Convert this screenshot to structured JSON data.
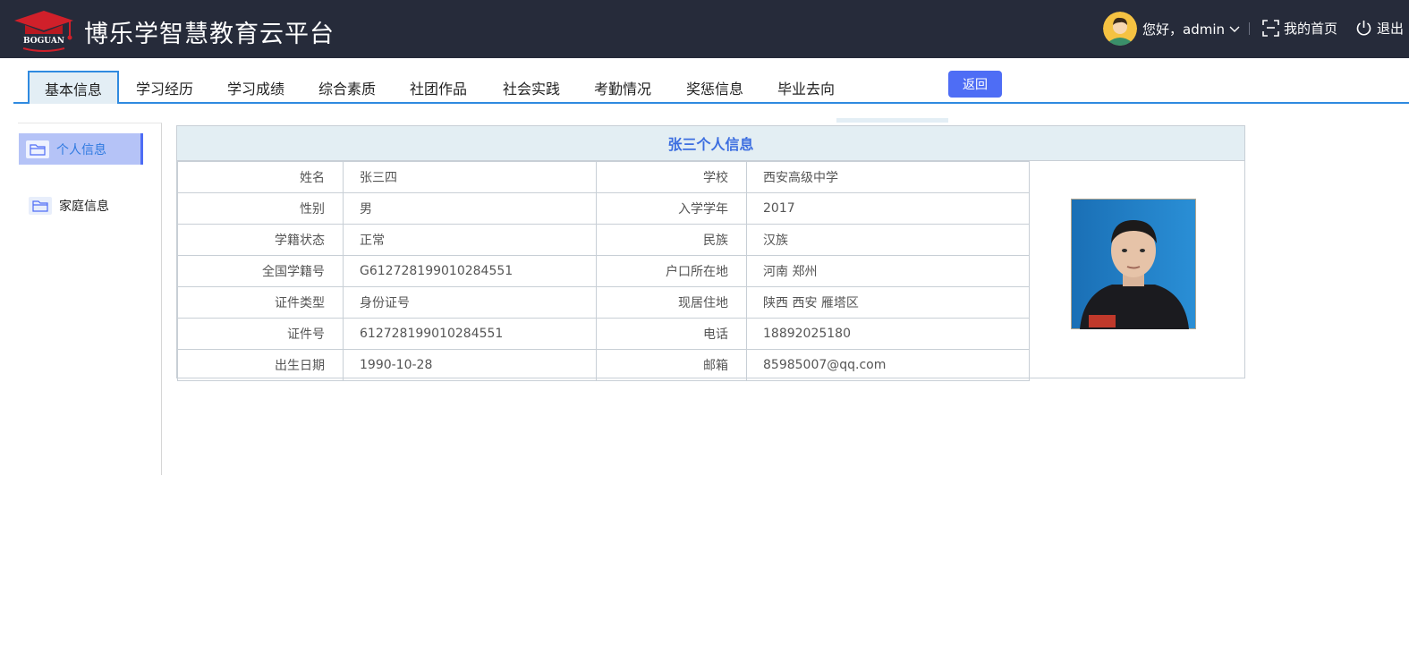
{
  "header": {
    "title": "博乐学智慧教育云平台",
    "logo_text": "BOGUAN",
    "greeting": "您好，admin",
    "home_label": "我的首页",
    "logout_label": "退出"
  },
  "tabs": [
    {
      "label": "基本信息",
      "active": true
    },
    {
      "label": "学习经历"
    },
    {
      "label": "学习成绩"
    },
    {
      "label": "综合素质"
    },
    {
      "label": "社团作品"
    },
    {
      "label": "社会实践"
    },
    {
      "label": "考勤情况"
    },
    {
      "label": "奖惩信息"
    },
    {
      "label": "毕业去向"
    }
  ],
  "back_label": "返回",
  "sidebar": {
    "items": [
      {
        "label": "个人信息",
        "active": true
      },
      {
        "label": "家庭信息"
      }
    ]
  },
  "panel": {
    "title": "张三个人信息",
    "rows": [
      {
        "l1": "姓名",
        "v1": "张三四",
        "l2": "学校",
        "v2": "西安高级中学"
      },
      {
        "l1": "性别",
        "v1": "男",
        "l2": "入学学年",
        "v2": "2017"
      },
      {
        "l1": "学籍状态",
        "v1": "正常",
        "l2": "民族",
        "v2": "汉族"
      },
      {
        "l1": "全国学籍号",
        "v1": "G612728199010284551",
        "l2": "户口所在地",
        "v2": "河南 郑州"
      },
      {
        "l1": "证件类型",
        "v1": "身份证号",
        "l2": "现居住地",
        "v2": "陕西 西安 雁塔区"
      },
      {
        "l1": "证件号",
        "v1": "612728199010284551",
        "l2": "电话",
        "v2": "18892025180"
      },
      {
        "l1": "出生日期",
        "v1": "1990-10-28",
        "l2": "邮箱",
        "v2": "85985007@qq.com"
      }
    ]
  },
  "colors": {
    "header_bg": "#262b3a",
    "accent": "#4e6df5",
    "label_blue": "#3c6ee0",
    "tab_border": "#2f8ae0"
  }
}
